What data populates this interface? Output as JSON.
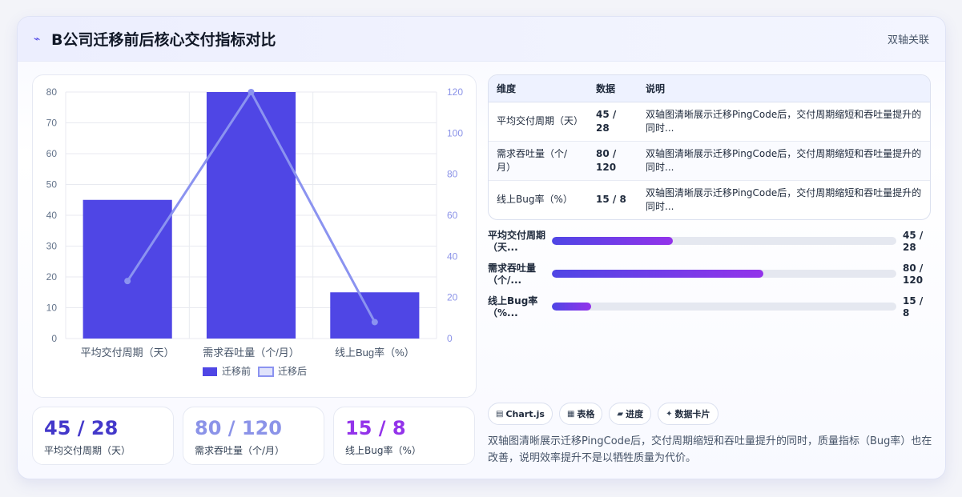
{
  "header": {
    "title": "B公司迁移前后核心交付指标对比",
    "tag": "双轴关联"
  },
  "chart_data": {
    "type": "bar",
    "categories": [
      "平均交付周期（天）",
      "需求吞吐量（个/月）",
      "线上Bug率（%）"
    ],
    "series": [
      {
        "name": "迁移前",
        "type": "bar",
        "axis": "left",
        "values": [
          45,
          80,
          15
        ]
      },
      {
        "name": "迁移后",
        "type": "line",
        "axis": "right",
        "values": [
          28,
          120,
          8
        ]
      }
    ],
    "y_left": {
      "min": 0,
      "max": 80,
      "ticks": [
        0,
        10,
        20,
        30,
        40,
        50,
        60,
        70,
        80
      ]
    },
    "y_right": {
      "min": 0,
      "max": 120,
      "ticks": [
        0,
        20,
        40,
        60,
        80,
        100,
        120
      ]
    },
    "legend_position": "bottom",
    "grid": true,
    "colors": {
      "bar": "#4f46e5",
      "line": "#8b93f0"
    }
  },
  "kpis": [
    {
      "value": "45 / 28",
      "label": "平均交付周期（天）",
      "color": "#4338ca"
    },
    {
      "value": "80 / 120",
      "label": "需求吞吐量（个/月）",
      "color": "#8b93e8"
    },
    {
      "value": "15 / 8",
      "label": "线上Bug率（%）",
      "color": "#9333ea"
    }
  ],
  "table": {
    "headers": [
      "维度",
      "数据",
      "说明"
    ],
    "rows": [
      [
        "平均交付周期（天）",
        "45 / 28",
        "双轴图清晰展示迁移PingCode后，交付周期缩短和吞吐量提升的同时..."
      ],
      [
        "需求吞吐量（个/月）",
        "80 / 120",
        "双轴图清晰展示迁移PingCode后，交付周期缩短和吞吐量提升的同时..."
      ],
      [
        "线上Bug率（%）",
        "15 / 8",
        "双轴图清晰展示迁移PingCode后，交付周期缩短和吞吐量提升的同时..."
      ]
    ]
  },
  "progress": [
    {
      "label": "平均交付周期（天...",
      "value": "45 / 28",
      "fraction": 0.35
    },
    {
      "label": "需求吞吐量（个/...",
      "value": "80 / 120",
      "fraction": 0.615
    },
    {
      "label": "线上Bug率（%...",
      "value": "15 / 8",
      "fraction": 0.115
    }
  ],
  "chips": [
    {
      "icon": "chart-icon",
      "label": "Chart.js"
    },
    {
      "icon": "table-icon",
      "label": "表格"
    },
    {
      "icon": "progress-icon",
      "label": "进度"
    },
    {
      "icon": "card-icon",
      "label": "数据卡片"
    }
  ],
  "description": "双轴图清晰展示迁移PingCode后，交付周期缩短和吞吐量提升的同时，质量指标（Bug率）也在改善，说明效率提升不是以牺牲质量为代价。"
}
